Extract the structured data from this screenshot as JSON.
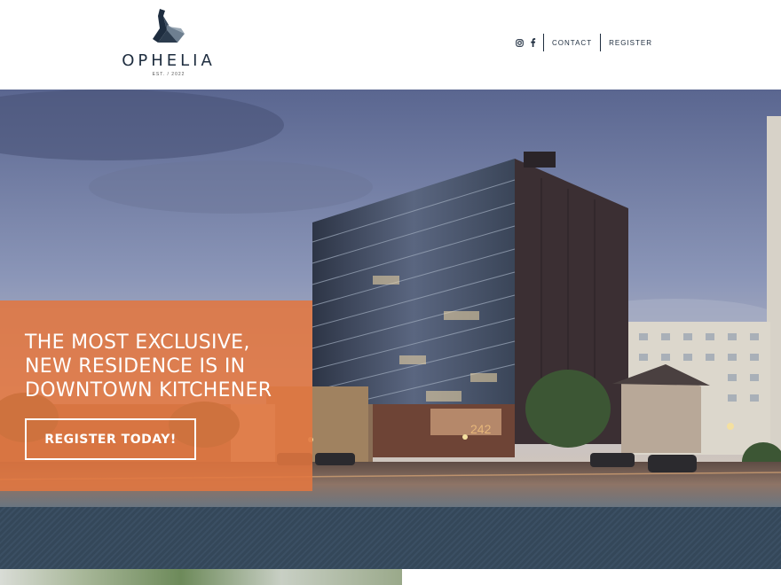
{
  "brand": {
    "name": "OPHELIA",
    "tagline": "EST. / 2022"
  },
  "nav": {
    "instagram_icon": "instagram-icon",
    "facebook_icon": "facebook-icon",
    "contact": "CONTACT",
    "register": "REGISTER"
  },
  "hero": {
    "headline": "THE MOST EXCLUSIVE, NEW RESIDENCE IS IN DOWNTOWN KITCHENER",
    "cta": "REGISTER TODAY!",
    "building_number": "242"
  },
  "colors": {
    "accent": "#e27640",
    "navy": "#1e2d3f",
    "band": "#344759"
  }
}
